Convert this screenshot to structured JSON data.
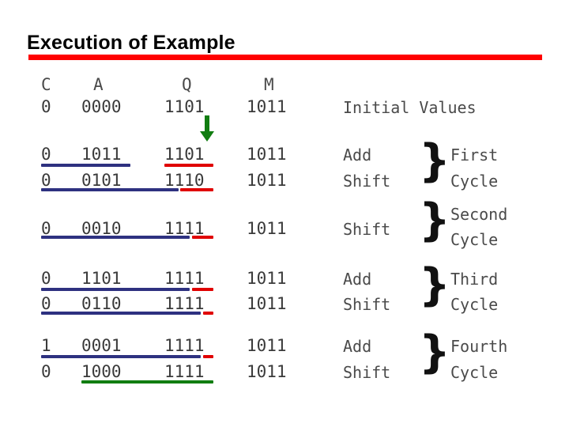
{
  "slide": {
    "title": "Execution of Example",
    "accent_color": "#ff0000",
    "blue_color": "#2e3180",
    "red_color": "#e00000",
    "green_color": "#117d11"
  },
  "table": {
    "headers": [
      "C",
      "A",
      "Q",
      "M"
    ],
    "rows": [
      {
        "c": "0",
        "a": "0000",
        "q": "1101",
        "m": "1011",
        "op": "",
        "note": "Initial Values"
      },
      {
        "c": "0",
        "a": "1011",
        "q": "1101",
        "m": "1011",
        "op": "Add",
        "note": ""
      },
      {
        "c": "0",
        "a": "0101",
        "q": "1110",
        "m": "1011",
        "op": "Shift",
        "note": ""
      },
      {
        "c": "0",
        "a": "0010",
        "q": "1111",
        "m": "1011",
        "op": "Shift",
        "note": ""
      },
      {
        "c": "0",
        "a": "1101",
        "q": "1111",
        "m": "1011",
        "op": "Add",
        "note": ""
      },
      {
        "c": "0",
        "a": "0110",
        "q": "1111",
        "m": "1011",
        "op": "Shift",
        "note": ""
      },
      {
        "c": "1",
        "a": "0001",
        "q": "1111",
        "m": "1011",
        "op": "Add",
        "note": ""
      },
      {
        "c": "0",
        "a": "1000",
        "q": "1111",
        "m": "1011",
        "op": "Shift",
        "note": ""
      }
    ]
  },
  "cycles": [
    {
      "brace": "}",
      "line1": "First",
      "line2": "Cycle"
    },
    {
      "brace": "}",
      "line1": "Second",
      "line2": "Cycle"
    },
    {
      "brace": "}",
      "line1": "Third",
      "line2": "Cycle"
    },
    {
      "brace": "}",
      "line1": "Fourth",
      "line2": "Cycle"
    }
  ],
  "icons": {
    "arrow_down": "arrow-down-icon"
  }
}
